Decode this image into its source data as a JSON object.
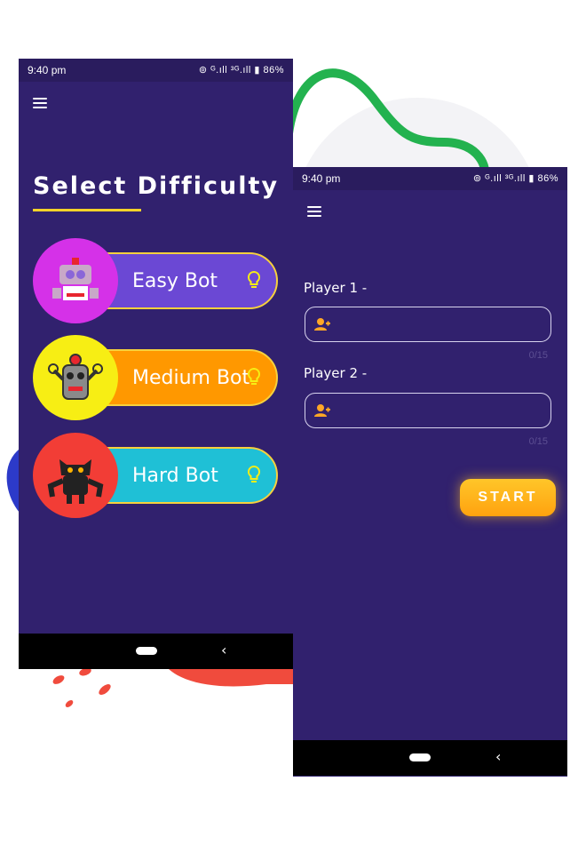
{
  "status_bar": {
    "time_left": "9:40 pm",
    "time_right": "9:40 pm",
    "icons_text": "⊚ ᴳ.ıll ³ᴳ.ıll ▮ 86%",
    "battery": "86%"
  },
  "difficulty_screen": {
    "title": "Select Difficulty",
    "bots": [
      {
        "label": "Easy Bot",
        "circle_color": "#d531e8",
        "pill_color": "#6b48d4",
        "icon": "robot-icon"
      },
      {
        "label": "Medium Bot",
        "circle_color": "#f7ee14",
        "pill_color": "#ff9800",
        "icon": "robot-icon"
      },
      {
        "label": "Hard Bot",
        "circle_color": "#f23d36",
        "pill_color": "#1fc0d6",
        "icon": "monster-robot-icon"
      }
    ],
    "bulb_color": "#f7ee14"
  },
  "player_screen": {
    "player1_label": "Player 1 -",
    "player2_label": "Player 2 -",
    "player1_value": "",
    "player2_value": "",
    "player1_counter": "0/15",
    "player2_counter": "0/15",
    "start_label": "START",
    "accent_color": "#ffb11a"
  },
  "nav": {
    "back_symbol": "‹"
  }
}
